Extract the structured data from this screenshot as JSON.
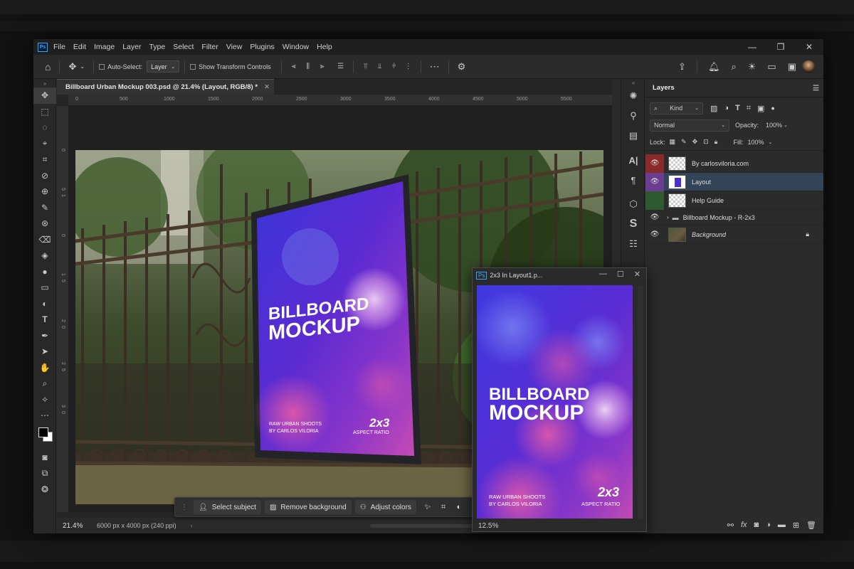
{
  "menubar": {
    "items": [
      "File",
      "Edit",
      "Image",
      "Layer",
      "Type",
      "Select",
      "Filter",
      "View",
      "Plugins",
      "Window",
      "Help"
    ]
  },
  "options": {
    "auto_select_label": "Auto-Select:",
    "auto_select_value": "Layer",
    "transform_label": "Show Transform Controls"
  },
  "document": {
    "tab_title": "Billboard Urban Mockup 003.psd @ 21.4% (Layout, RGB/8) *",
    "ruler_top": [
      "0",
      "500",
      "1000",
      "1500",
      "2000",
      "2500",
      "3000",
      "3500",
      "4000",
      "4500",
      "5000",
      "5500"
    ],
    "ruler_left": [
      "0",
      "5",
      "1",
      "0",
      "1",
      "5",
      "2",
      "0",
      "2",
      "5",
      "3",
      "0"
    ],
    "zoom": "21.4%",
    "doc_info": "6000 px x 4000 px (240 ppi)"
  },
  "poster": {
    "title_line1": "BILLBOARD",
    "title_line2": "MOCKUP",
    "credit_line1": "RAW URBAN SHOOTS",
    "credit_line2": "BY CARLOS VILORIA",
    "ratio": "2x3",
    "ratio_sub": "ASPECT RATIO"
  },
  "contextbar": {
    "select_subject": "Select subject",
    "remove_background": "Remove background",
    "adjust_colors": "Adjust colors"
  },
  "floatwin": {
    "title": "2x3 In Layout1.p...",
    "zoom": "12.5%"
  },
  "layers": {
    "tab": "Layers",
    "kind": "Kind",
    "blend": "Normal",
    "opacity_label": "Opacity:",
    "opacity": "100%",
    "lock_label": "Lock:",
    "fill_label": "Fill:",
    "fill": "100%",
    "items": [
      {
        "name": "By carlosviloria.com"
      },
      {
        "name": "Layout"
      },
      {
        "name": "Help Guide"
      },
      {
        "name": "Billboard Mockup - R-2x3"
      },
      {
        "name": "Background"
      }
    ]
  },
  "colors": {
    "accent": "#31a8ff",
    "selected_layer": "#334358",
    "poster_purple": "#4b2fc7"
  }
}
